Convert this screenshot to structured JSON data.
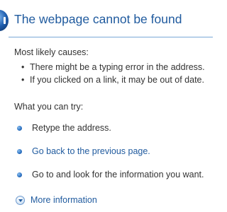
{
  "header": {
    "title": "The webpage cannot be found",
    "icon": "info-icon"
  },
  "causes": {
    "label": "Most likely causes:",
    "items": [
      "There might be a typing error in the address.",
      "If you clicked on a link, it may be out of date."
    ]
  },
  "actions": {
    "label": "What you can try:",
    "retype": "Retype the address.",
    "go_back": "Go back to the previous page.",
    "look_for": "Go to  and look for the information you want.",
    "more_info": "More information"
  },
  "colors": {
    "title": "#1f5a9e",
    "link": "#1f5a9e",
    "divider": "#7aa8d6",
    "text": "#333333"
  }
}
